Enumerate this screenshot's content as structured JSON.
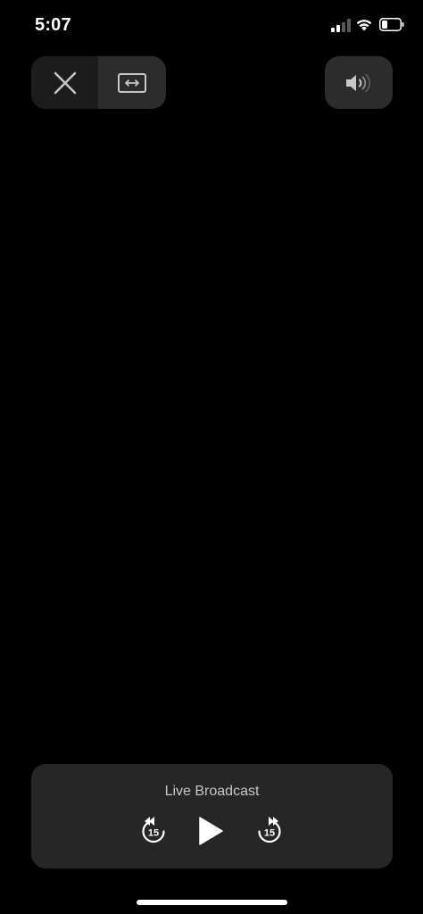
{
  "status_bar": {
    "time": "5:07",
    "signal_icon": "cellular-signal-icon",
    "wifi_icon": "wifi-icon",
    "battery_icon": "battery-icon"
  },
  "top_controls": {
    "close_icon": "close-icon",
    "aspect_icon": "aspect-ratio-icon",
    "volume_icon": "speaker-volume-icon"
  },
  "player": {
    "title": "Live Broadcast",
    "skip_back_label": "15",
    "skip_forward_label": "15",
    "play_icon": "play-icon"
  },
  "colors": {
    "background": "#000000",
    "panel": "#262626",
    "button_dark": "#1c1c1e",
    "button_light": "#2c2c2e",
    "icon": "#c7c7c7"
  }
}
